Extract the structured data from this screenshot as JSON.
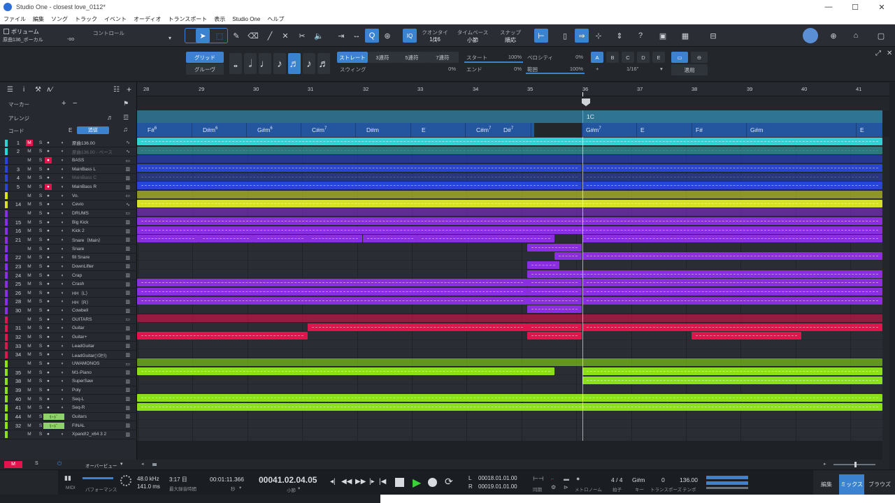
{
  "window": {
    "title": "Studio One - closest love_0112*",
    "controls": [
      "—",
      "☐",
      "✕"
    ]
  },
  "menu": [
    "ファイル",
    "編集",
    "ソング",
    "トラック",
    "イベント",
    "オーディオ",
    "トランスポート",
    "表示",
    "Studio One",
    "ヘルプ"
  ],
  "toolbar": {
    "volume_label": "ボリューム",
    "track_label": "原曲136_ボーカル",
    "volume_value": "-oo",
    "control_label": "コントロール",
    "quantize_label": "クオンタイズ",
    "quantize_value": "1/16",
    "timebase_label": "タイムベース",
    "timebase_value": "小節",
    "snap_label": "スナップ",
    "snap_value": "順応",
    "iq": "IQ"
  },
  "quantize_panel": {
    "grid": "グリッド",
    "groove": "グルーヴ",
    "straight": "ストレート",
    "triplet3": "3連符",
    "triplet5": "5連符",
    "triplet7": "7連符",
    "swing": "スウィング",
    "swing_value": "0%",
    "start": "スタート",
    "start_value": "100%",
    "end": "エンド",
    "end_value": "0%",
    "velocity": "ベロシティ",
    "velocity_value": "0%",
    "range": "範囲",
    "range_value": "100%",
    "presets": [
      "A",
      "B",
      "C",
      "D",
      "E"
    ],
    "plus": "+",
    "grid_value": "1/16\"",
    "apply": "適用"
  },
  "header": {
    "marker": "マーカー",
    "arrange": "アレンジ",
    "chord": "コード",
    "chord_key": "E",
    "chord_follow": "追従"
  },
  "ruler": [
    "28",
    "29",
    "30",
    "31",
    "32",
    "33",
    "34",
    "35",
    "36",
    "37",
    "38",
    "39",
    "40",
    "41"
  ],
  "arranger_section": "1C",
  "chords": [
    {
      "base": "F#",
      "ext": "6"
    },
    {
      "base": "D#m",
      "ext": "6"
    },
    {
      "base": "G#m",
      "ext": "6"
    },
    {
      "base": "C#m",
      "ext": "7"
    },
    {
      "base": "D#m",
      "ext": ""
    },
    {
      "base": "E",
      "ext": ""
    },
    {
      "base": "C#m",
      "ext": "7"
    },
    {
      "base": "D#",
      "ext": "7"
    },
    {
      "base": "G#m",
      "ext": "7"
    },
    {
      "base": "E",
      "ext": ""
    },
    {
      "base": "F#",
      "ext": ""
    },
    {
      "base": "G#m",
      "ext": ""
    },
    {
      "base": "E",
      "ext": ""
    }
  ],
  "tracks": [
    {
      "num": "1",
      "name": "原曲136.00",
      "color": "#2fd3d3",
      "mute_on": true
    },
    {
      "num": "2",
      "name": "原曲136.00 - ベース",
      "color": "#2fd3d3",
      "dim": true
    },
    {
      "num": "",
      "name": "BASS",
      "color": "#2a44d6",
      "folder": true,
      "rec_on": true
    },
    {
      "num": "3",
      "name": "MainBass L",
      "color": "#2a44d6"
    },
    {
      "num": "4",
      "name": "MainBass C",
      "color": "#2a44d6",
      "dim": true
    },
    {
      "num": "5",
      "name": "MainBass R",
      "color": "#2a44d6",
      "rec_on": true
    },
    {
      "num": "",
      "name": "Vo.",
      "color": "#d6e02a",
      "folder": true
    },
    {
      "num": "14",
      "name": "Cevio",
      "color": "#d6e02a"
    },
    {
      "num": "",
      "name": "DRUMS",
      "color": "#8b2ee0",
      "folder": true
    },
    {
      "num": "15",
      "name": "Big Kick",
      "color": "#8b2ee0"
    },
    {
      "num": "16",
      "name": "Kick 2",
      "color": "#8b2ee0"
    },
    {
      "num": "21",
      "name": "Snare（Main）",
      "color": "#8b2ee0"
    },
    {
      "num": "",
      "name": "Snare",
      "color": "#8b2ee0"
    },
    {
      "num": "22",
      "name": "fill Snare",
      "color": "#8b2ee0"
    },
    {
      "num": "23",
      "name": "DownLifter",
      "color": "#8b2ee0"
    },
    {
      "num": "24",
      "name": "Crap",
      "color": "#8b2ee0"
    },
    {
      "num": "25",
      "name": "Crash",
      "color": "#8b2ee0"
    },
    {
      "num": "26",
      "name": "HH（L）",
      "color": "#8b2ee0"
    },
    {
      "num": "28",
      "name": "HH（R）",
      "color": "#8b2ee0"
    },
    {
      "num": "30",
      "name": "Cowbell",
      "color": "#8b2ee0"
    },
    {
      "num": "",
      "name": "GUITARS",
      "color": "#e0154e",
      "folder": true
    },
    {
      "num": "31",
      "name": "Guitar",
      "color": "#e0154e"
    },
    {
      "num": "32",
      "name": "Guitar+",
      "color": "#e0154e"
    },
    {
      "num": "33",
      "name": "LeadGuitar",
      "color": "#e0154e"
    },
    {
      "num": "34",
      "name": "LeadGuitar(ｿﾛｾﾘ)",
      "color": "#e0154e"
    },
    {
      "num": "",
      "name": "UWAMONOS",
      "color": "#8ce01a",
      "folder": true
    },
    {
      "num": "35",
      "name": "M1-Piano",
      "color": "#8ce01a"
    },
    {
      "num": "38",
      "name": "SuperSaw",
      "color": "#8ce01a"
    },
    {
      "num": "39",
      "name": "Poly",
      "color": "#8ce01a"
    },
    {
      "num": "40",
      "name": "Seq-L",
      "color": "#8ce01a"
    },
    {
      "num": "41",
      "name": "Seq-R",
      "color": "#8ce01a"
    },
    {
      "num": "44",
      "name": "Guitars",
      "color": "#8ce01a",
      "bus": true
    },
    {
      "num": "32",
      "name": "FINAL",
      "color": "#8ce01a",
      "bus": true
    },
    {
      "num": "",
      "name": "Xpand!2_x64 3 2",
      "color": "#8ce01a"
    }
  ],
  "bottom_strip": {
    "overview": "オーバービュー"
  },
  "transport": {
    "midi": "MIDI",
    "performance": "パフォーマンス",
    "sample_rate": "48.0 kHz",
    "latency": "141.0 ms",
    "record_time": "3:17 日",
    "record_time_label": "最大録音時間",
    "seconds": "00:01:11.366",
    "seconds_label": "秒",
    "position": "00041.02.04.05",
    "position_label": "小節",
    "loop_l": "L",
    "loop_l_value": "00018.01.01.00",
    "loop_r": "R",
    "loop_r_value": "00019.01.01.00",
    "sync_label": "同期",
    "metronome_label": "メトロノーム",
    "time_sig": "4 / 4",
    "time_sig_label": "拍子",
    "key": "G#m",
    "key_label": "キー",
    "transpose": "0",
    "transpose_label": "トランスポーズ",
    "tempo": "136.00",
    "tempo_label": "テンポ",
    "edit": "編集",
    "mix": "ミックス",
    "browse": "ブラウズ"
  },
  "colors": {
    "accent": "#3b83d1",
    "audio": "#2fd3d3",
    "bass": "#2a44d6",
    "vocal": "#d6e02a",
    "drums": "#8b2ee0",
    "guitars": "#e0154e",
    "synths": "#8ce01a"
  }
}
